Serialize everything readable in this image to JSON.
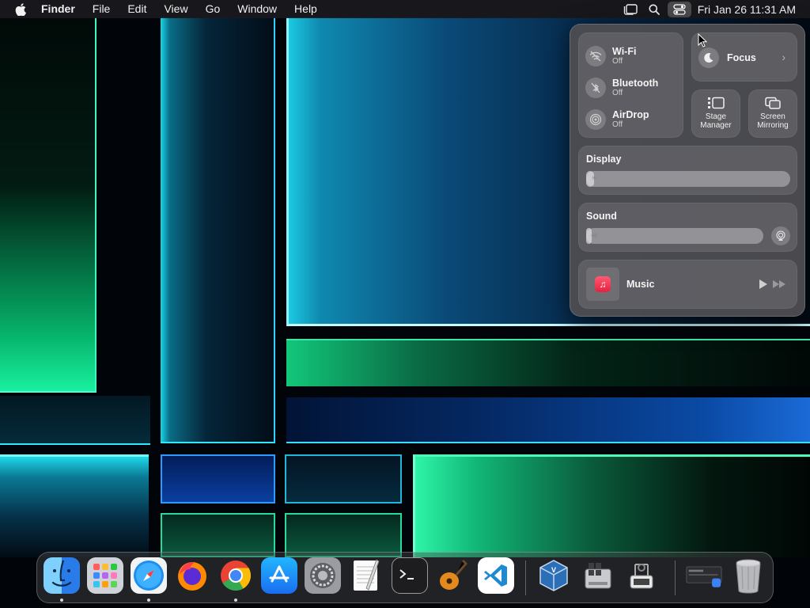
{
  "menubar": {
    "apple_icon": "apple-logo-icon",
    "app_name": "Finder",
    "menus": [
      "File",
      "Edit",
      "View",
      "Go",
      "Window",
      "Help"
    ],
    "status_icons": [
      "stage-manager-icon",
      "spotlight-search-icon",
      "control-center-icon"
    ],
    "clock": "Fri Jan 26  11:31 AM"
  },
  "control_center": {
    "wifi": {
      "title": "Wi-Fi",
      "status": "Off"
    },
    "bluetooth": {
      "title": "Bluetooth",
      "status": "Off"
    },
    "airdrop": {
      "title": "AirDrop",
      "status": "Off"
    },
    "focus": {
      "label": "Focus"
    },
    "stage_manager": {
      "line1": "Stage",
      "line2": "Manager"
    },
    "screen_mirroring": {
      "line1": "Screen",
      "line2": "Mirroring"
    },
    "display": {
      "title": "Display",
      "level": 0.04
    },
    "sound": {
      "title": "Sound",
      "level": 0.03
    },
    "music": {
      "title": "Music"
    }
  },
  "dock": {
    "apps": [
      {
        "name": "Finder",
        "icon": "finder-icon",
        "running": true
      },
      {
        "name": "Launchpad",
        "icon": "launchpad-icon",
        "running": false
      },
      {
        "name": "Safari",
        "icon": "safari-icon",
        "running": true
      },
      {
        "name": "Firefox",
        "icon": "firefox-icon",
        "running": false
      },
      {
        "name": "Google Chrome",
        "icon": "chrome-icon",
        "running": true
      },
      {
        "name": "App Store",
        "icon": "app-store-icon",
        "running": false
      },
      {
        "name": "System Settings",
        "icon": "system-settings-icon",
        "running": false
      },
      {
        "name": "TextEdit",
        "icon": "textedit-icon",
        "running": false
      },
      {
        "name": "Terminal",
        "icon": "terminal-icon",
        "running": false
      },
      {
        "name": "GarageBand",
        "icon": "garageband-icon",
        "running": false
      },
      {
        "name": "Visual Studio Code",
        "icon": "vscode-icon",
        "running": false
      },
      {
        "name": "VirtualBox",
        "icon": "virtualbox-icon",
        "running": false
      },
      {
        "name": "Boot Camp Assistant",
        "icon": "bootcamp-icon",
        "running": false
      },
      {
        "name": "System Information",
        "icon": "system-information-icon",
        "running": false
      }
    ],
    "stack_icon": "downloads-stack-icon",
    "trash_icon": "trash-icon"
  }
}
